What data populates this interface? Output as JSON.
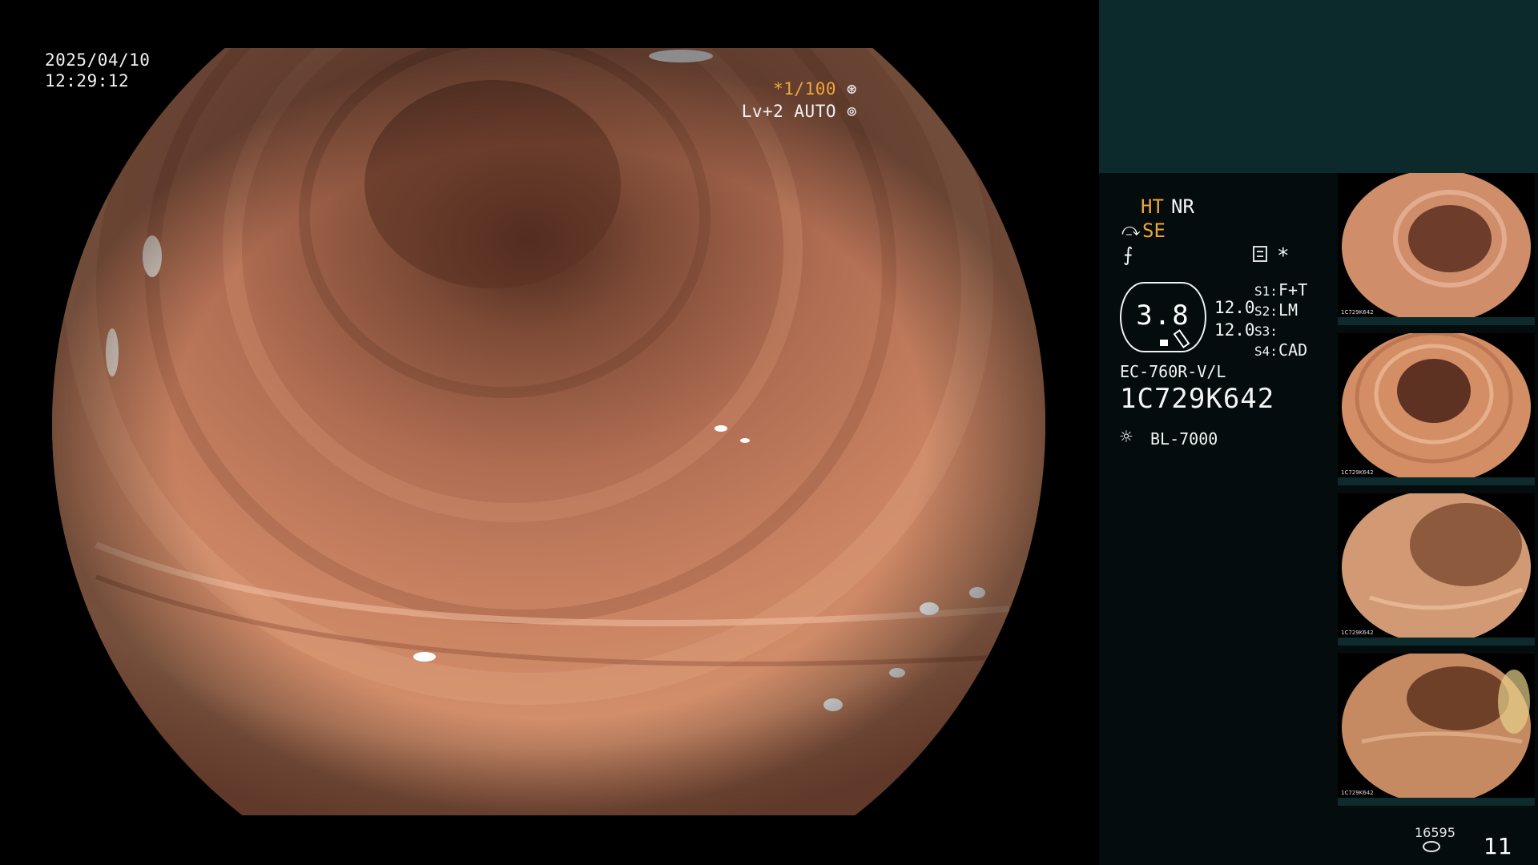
{
  "overlay": {
    "date": "2025/04/10",
    "time": "12:29:12",
    "shutter": "*1/100",
    "shutter_icon": "⊛",
    "level": "Lv+2 AUTO",
    "level_icon": "⊚"
  },
  "panel": {
    "ht_label": "HT",
    "nr_label": "NR",
    "se_icon": "⤼",
    "se_label": "SE",
    "wave_icon": "⨍",
    "star_icon": "*",
    "gauge_value": "3.8",
    "value_a": "12.0",
    "value_b": "12.0",
    "s1_key": "S1:",
    "s1_value": "F+T",
    "s2_key": "S2:",
    "s2_value": "LM",
    "s3_key": "S3:",
    "s3_value": "",
    "s4_key": "S4:",
    "s4_value": "CAD",
    "scope_model": "EC-760R-V/L",
    "scope_serial": "1C729K642",
    "light_icon": "☼",
    "light_model": "BL-7000"
  },
  "thumbnails": [
    {
      "id_label": "1C729K642"
    },
    {
      "id_label": "1C729K642"
    },
    {
      "id_label": "1C729K642"
    },
    {
      "id_label": "1C729K642"
    }
  ],
  "footer": {
    "frame_count": "16595",
    "page_number": "11"
  },
  "colors": {
    "background": "#000000",
    "panel_background": "#040c0d",
    "panel_header": "#0c2a2c",
    "highlight": "#f0a43a",
    "tissue": "#c98362"
  },
  "icons": {
    "shutter": "shutter-icon",
    "level": "auto-level-icon",
    "settings": "settings-panel-icon",
    "light_source": "light-source-icon",
    "storage": "storage-icon"
  }
}
